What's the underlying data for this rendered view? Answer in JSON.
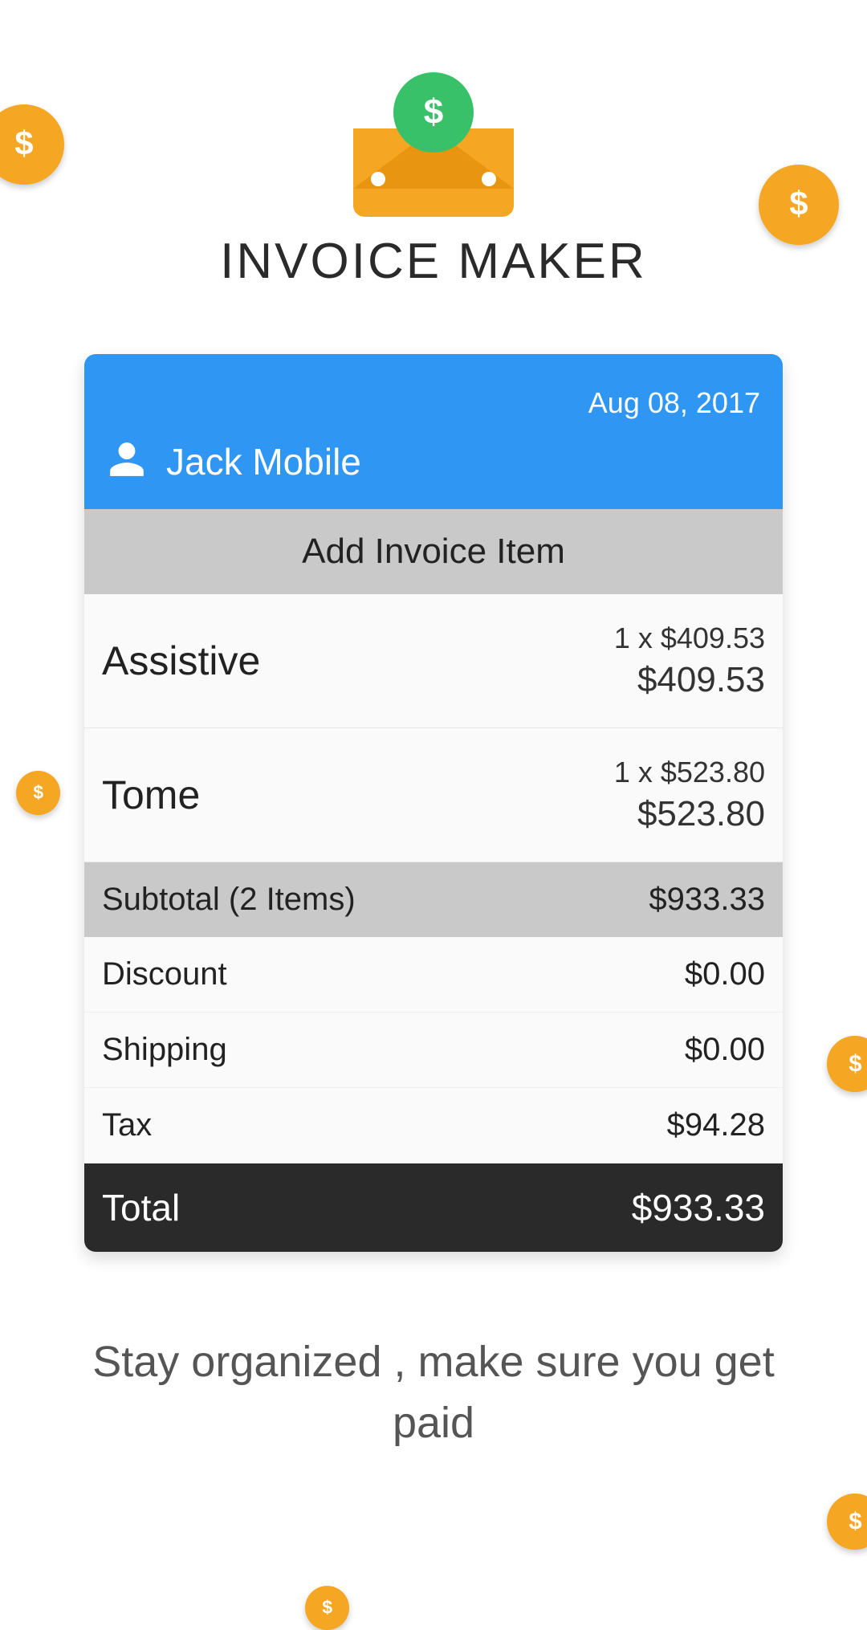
{
  "app": {
    "title": "INVOICE MAKER",
    "tagline": "Stay organized , make sure you get paid"
  },
  "invoice": {
    "date": "Aug 08, 2017",
    "customer_name": "Jack Mobile",
    "add_item_label": "Add Invoice Item",
    "items": [
      {
        "name": "Assistive",
        "qty_price": "1 x $409.53",
        "line_total": "$409.53"
      },
      {
        "name": "Tome",
        "qty_price": "1 x $523.80",
        "line_total": "$523.80"
      }
    ],
    "subtotal_label": "Subtotal (2 Items)",
    "subtotal_value": "$933.33",
    "discount_label": "Discount",
    "discount_value": "$0.00",
    "shipping_label": "Shipping",
    "shipping_value": "$0.00",
    "tax_label": "Tax",
    "tax_value": "$94.28",
    "total_label": "Total",
    "total_value": "$933.33"
  }
}
